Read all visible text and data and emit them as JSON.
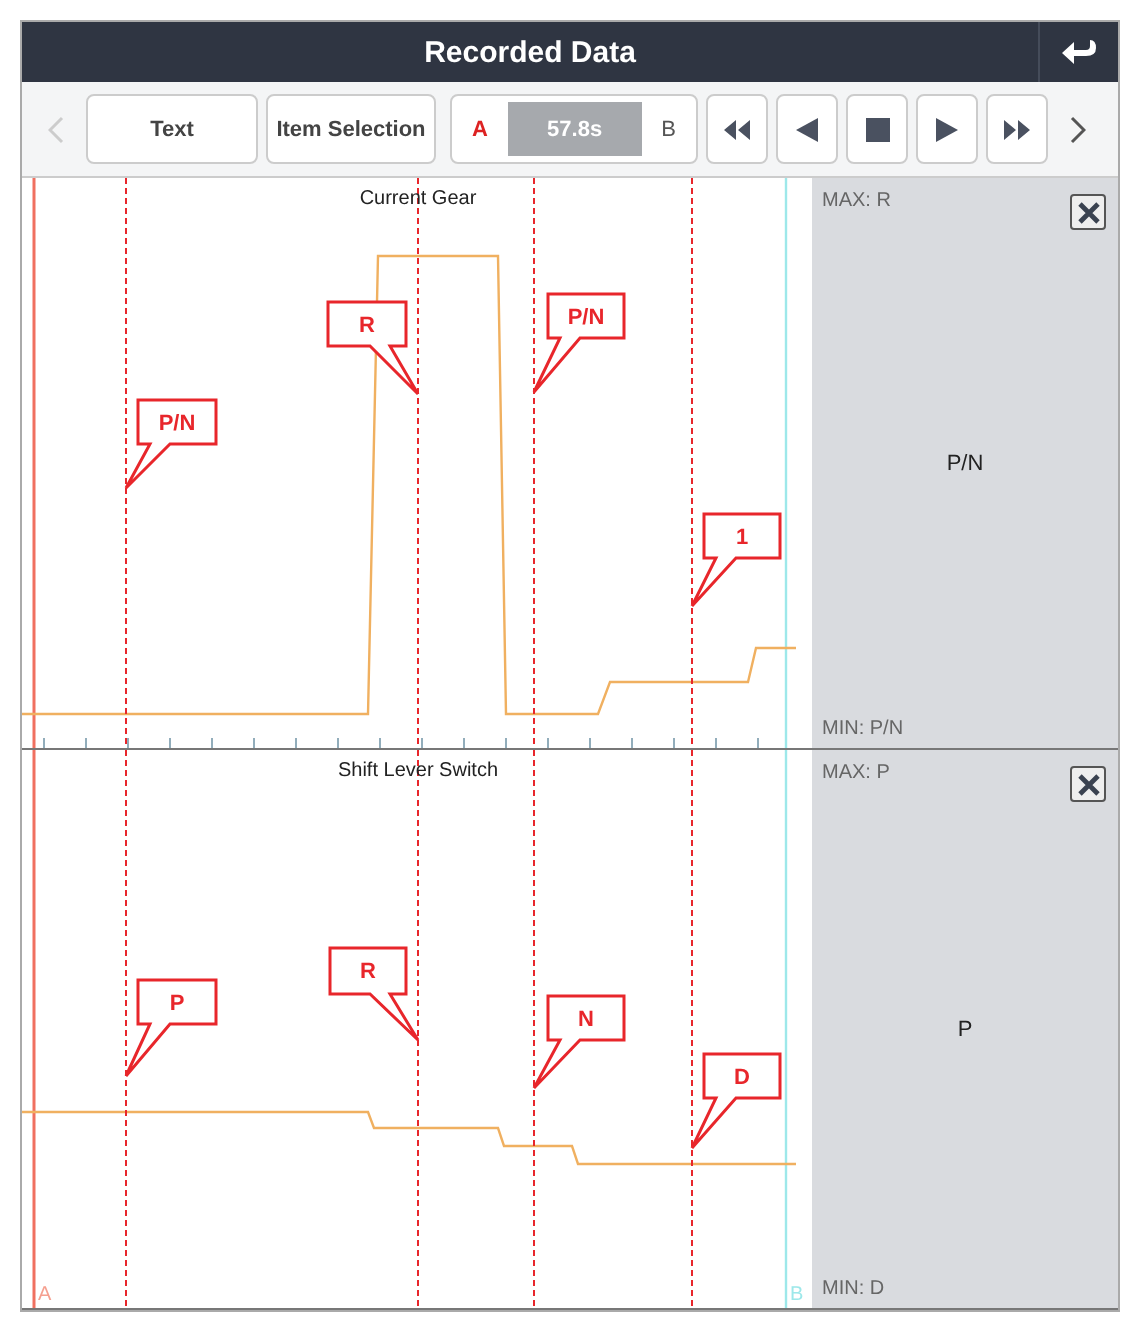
{
  "window": {
    "title": "Recorded Data"
  },
  "toolbar": {
    "text_button": "Text",
    "item_selection_button": "Item Selection",
    "cursor_a": "A",
    "time": "57.8s",
    "cursor_b": "B"
  },
  "panels": [
    {
      "title": "Current Gear",
      "max": "MAX: R",
      "min": "MIN: P/N",
      "value": "P/N",
      "markers": [
        {
          "label": "P/N"
        },
        {
          "label": "R"
        },
        {
          "label": "P/N"
        },
        {
          "label": "1"
        }
      ]
    },
    {
      "title": "Shift Lever Switch",
      "max": "MAX: P",
      "min": "MIN: D",
      "value": "P",
      "markers": [
        {
          "label": "P"
        },
        {
          "label": "R"
        },
        {
          "label": "N"
        },
        {
          "label": "D"
        }
      ]
    }
  ],
  "cursor_labels": {
    "a": "A",
    "b": "B"
  }
}
